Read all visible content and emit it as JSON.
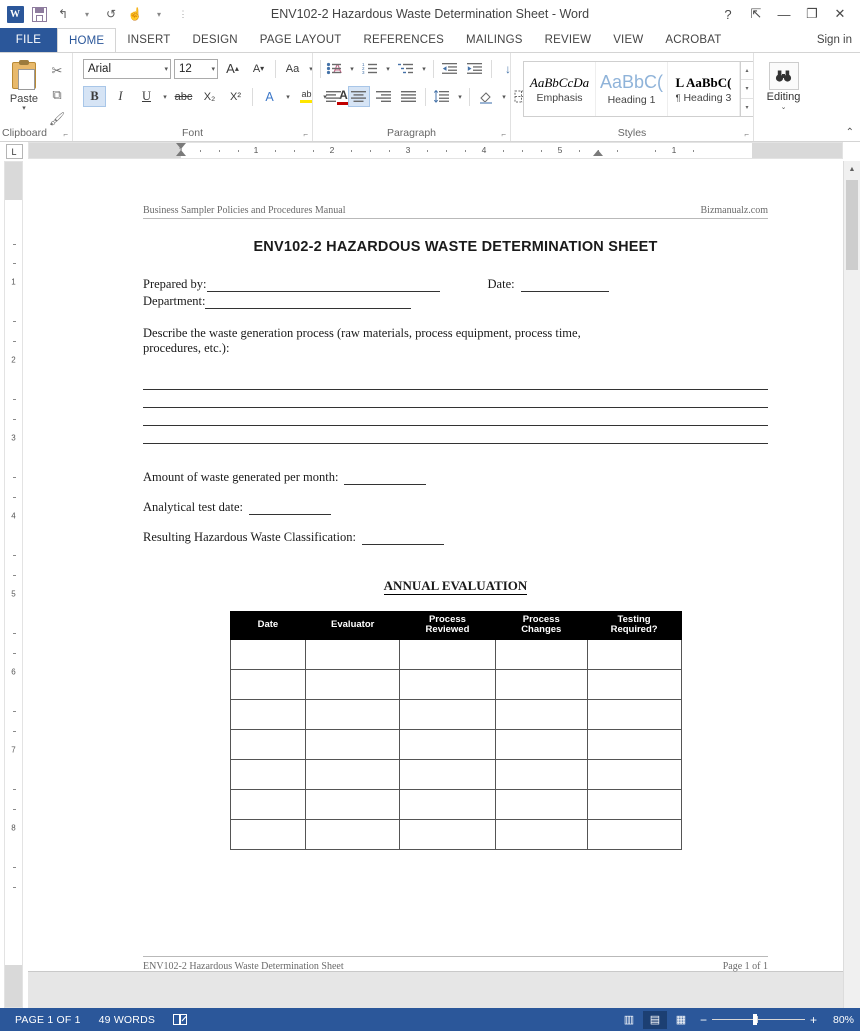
{
  "window": {
    "title": "ENV102-2 Hazardous Waste Determination Sheet - Word",
    "app_icon": "W",
    "quick_access": [
      {
        "name": "save-icon",
        "label": "Save"
      },
      {
        "name": "undo-icon",
        "label": "↰"
      },
      {
        "name": "redo-icon",
        "label": "↻"
      },
      {
        "name": "touch-mode-icon",
        "label": "☝"
      },
      {
        "name": "customize-qat-icon",
        "label": "⋮"
      }
    ],
    "controls": {
      "help": "?",
      "ribbon_display": "⇱",
      "minimize": "—",
      "restore": "❐",
      "close": "✕"
    }
  },
  "ribbon": {
    "tabs": [
      {
        "label": "FILE",
        "active": false,
        "file": true
      },
      {
        "label": "HOME",
        "active": true
      },
      {
        "label": "INSERT",
        "active": false
      },
      {
        "label": "DESIGN",
        "active": false
      },
      {
        "label": "PAGE LAYOUT",
        "active": false
      },
      {
        "label": "REFERENCES",
        "active": false
      },
      {
        "label": "MAILINGS",
        "active": false
      },
      {
        "label": "REVIEW",
        "active": false
      },
      {
        "label": "VIEW",
        "active": false
      },
      {
        "label": "ACROBAT",
        "active": false
      }
    ],
    "sign_in": "Sign in",
    "collapse_caret": "⌃",
    "groups": {
      "clipboard": {
        "label": "Clipboard",
        "paste_label": "Paste",
        "paste_caret": "▾",
        "dialog_launcher": "⌐",
        "items": [
          {
            "name": "cut-icon",
            "glyph": "✂"
          },
          {
            "name": "copy-icon",
            "glyph": "⧉"
          },
          {
            "name": "format-painter-icon",
            "glyph": "🖌"
          }
        ]
      },
      "font": {
        "label": "Font",
        "dialog_launcher": "⌐",
        "font_name": "Arial",
        "font_size": "12",
        "grow_font": "A",
        "shrink_font": "A",
        "change_case": "Aa",
        "clear_formatting": "A",
        "bold": "B",
        "italic": "I",
        "underline": "U",
        "strikethrough": "abc",
        "subscript": "X₂",
        "superscript": "X²",
        "text_effects": "A",
        "highlight": "ab",
        "font_color": "A",
        "font_color_hex": "#c00000",
        "highlight_hex": "#ffe600"
      },
      "paragraph": {
        "label": "Paragraph",
        "dialog_launcher": "⌐",
        "bullets": "bullets-icon",
        "numbering": "numbering-icon",
        "multilevel": "multilevel-list-icon",
        "decrease_indent": "decrease-indent-icon",
        "increase_indent": "increase-indent-icon",
        "sort": "sort-icon",
        "show_marks": "¶",
        "align_left": "align-left-icon",
        "align_center": "align-center-icon",
        "align_right": "align-right-icon",
        "justify": "justify-icon",
        "line_spacing": "line-spacing-icon",
        "shading": "shading-icon",
        "borders": "borders-icon"
      },
      "styles": {
        "label": "Styles",
        "dialog_launcher": "⌐",
        "items": [
          {
            "preview": "AaBbCcDa",
            "name": "Emphasis",
            "style": "emphasis"
          },
          {
            "preview": "AaBbC(",
            "name": "Heading 1",
            "style": "heading1"
          },
          {
            "preview": "AaBbC(",
            "name": "Heading 3",
            "style": "heading3",
            "prefix": "L",
            "para_mark": "¶"
          }
        ],
        "scroll_up": "▴",
        "scroll_down": "▾",
        "more": "▾"
      },
      "editing": {
        "label": "Editing",
        "button_label": "Editing",
        "icon": "binoculars-icon",
        "caret": "⌄"
      }
    }
  },
  "ruler": {
    "tab_selector": "L",
    "horizontal_numbers": [
      "1",
      "1",
      "2",
      "3",
      "4",
      "5",
      "1"
    ],
    "vertical_numbers": [
      "1",
      "2",
      "3",
      "4",
      "5",
      "6",
      "7",
      "8"
    ]
  },
  "document": {
    "header": {
      "left": "Business Sampler Policies and Procedures Manual",
      "right": "Bizmanualz.com"
    },
    "title": "ENV102-2   HAZARDOUS WASTE DETERMINATION SHEET",
    "fields": [
      {
        "label": "Prepared by:",
        "name": "prepared-by-field"
      },
      {
        "label": "Date:",
        "name": "date-field"
      },
      {
        "label": "Department:",
        "name": "department-field"
      }
    ],
    "describe_prompt": "Describe the waste generation process (raw materials, process equipment, process time, procedures, etc.):",
    "blank_line_count": 4,
    "short_fields": [
      {
        "label": "Amount of waste generated per month:",
        "name": "amount-waste-field"
      },
      {
        "label": "Analytical test date:",
        "name": "analytical-test-date-field"
      },
      {
        "label": "Resulting Hazardous Waste Classification:",
        "name": "waste-classification-field"
      }
    ],
    "table_section_title": "ANNUAL EVALUATION",
    "table": {
      "columns": [
        "Date",
        "Evaluator",
        "Process Reviewed",
        "Process Changes",
        "Testing Required?"
      ],
      "column_lines": [
        [
          "Date"
        ],
        [
          "Evaluator"
        ],
        [
          "Process",
          "Reviewed"
        ],
        [
          "Process",
          "Changes"
        ],
        [
          "Testing",
          "Required?"
        ]
      ],
      "row_count": 7
    },
    "footer": {
      "left": "ENV102-2 Hazardous Waste Determination Sheet",
      "right": "Page 1 of 1"
    }
  },
  "status_bar": {
    "page": "PAGE 1 OF 1",
    "words": "49 WORDS",
    "proofing_icon": "proofing-errors-icon",
    "views": [
      {
        "name": "read-mode-icon",
        "glyph": "▥",
        "selected": false
      },
      {
        "name": "print-layout-icon",
        "glyph": "▤",
        "selected": true
      },
      {
        "name": "web-layout-icon",
        "glyph": "▦",
        "selected": false
      }
    ],
    "zoom_out": "−",
    "zoom_in": "+",
    "zoom_value": "80%"
  },
  "colors": {
    "accent": "#2b579a",
    "ribbon_bg": "#ffffff",
    "page_bg": "#e6e6e6"
  }
}
